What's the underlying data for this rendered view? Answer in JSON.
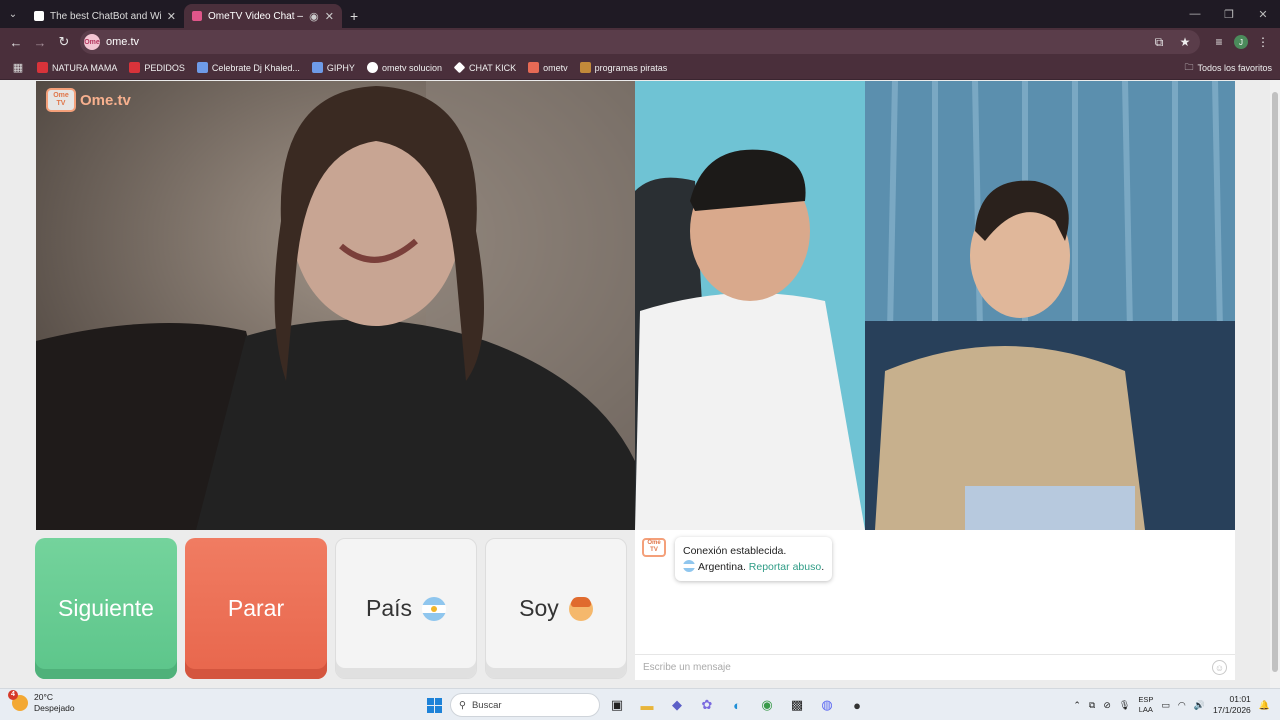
{
  "browser": {
    "tabs": [
      {
        "title": "The best ChatBot and Widgets",
        "color": "#ffffff",
        "active": false
      },
      {
        "title": "OmeTV Video Chat — Ome",
        "color": "#e0568a",
        "active": true
      }
    ],
    "url": "ome.tv",
    "site_badge": "Ome",
    "bookmarks": [
      {
        "label": "NATURA MAMA",
        "color": "#d8333a"
      },
      {
        "label": "PEDIDOS",
        "color": "#d8333a"
      },
      {
        "label": "Celebrate Dj Khaled...",
        "color": "#6e9be8"
      },
      {
        "label": "GIPHY",
        "color": "#6e9be8"
      },
      {
        "label": "ometv solucion",
        "color": "#ffffff"
      },
      {
        "label": "CHAT KICK",
        "color": "#ffffff"
      },
      {
        "label": "ometv",
        "color": "#e66a55"
      },
      {
        "label": "programas piratas",
        "color": "#c28a3a"
      }
    ],
    "bookmarks_folder": "Todos los favoritos",
    "profile_initial": "J"
  },
  "page": {
    "logo_text": "Ome.tv",
    "logo_badge": "Ome TV",
    "buttons": {
      "next": "Siguiente",
      "stop": "Parar",
      "country": "País",
      "me": "Soy"
    },
    "chat": {
      "status": "Conexión establecida.",
      "country": "Argentina.",
      "report": "Reportar abuso",
      "report_suffix": ".",
      "placeholder": "Escribe un mensaje"
    }
  },
  "taskbar": {
    "weather_temp": "20°C",
    "weather_desc": "Despejado",
    "weather_badge": "4",
    "search_placeholder": "Buscar",
    "lang_top": "ESP",
    "lang_bottom": "LAA",
    "time": "01:01",
    "date": "17/1/2026"
  }
}
